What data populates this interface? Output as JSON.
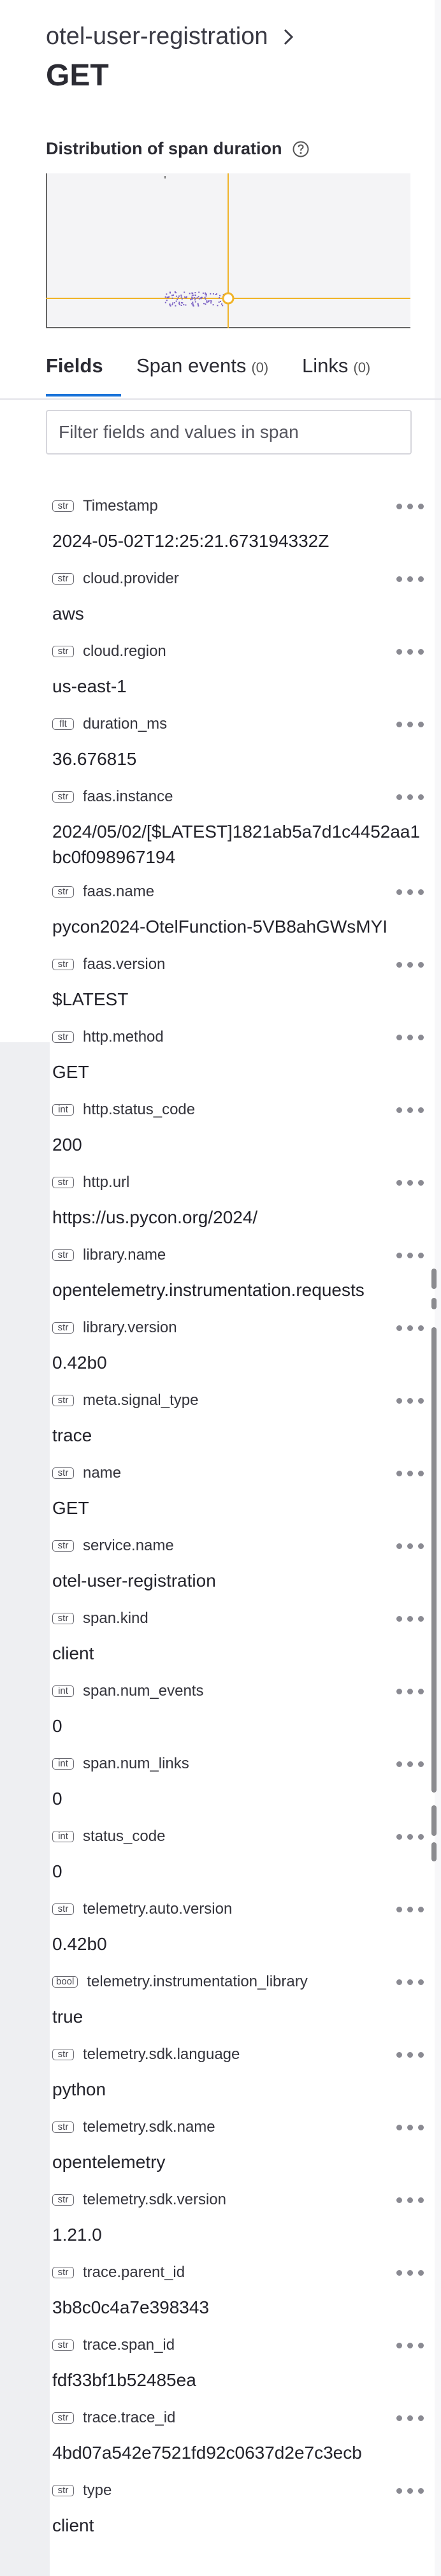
{
  "header": {
    "breadcrumb": "otel-user-registration",
    "title": "GET"
  },
  "distribution": {
    "title": "Distribution of span duration"
  },
  "colors": {
    "accent": "#1a73d9",
    "highlight_line": "#f0b429",
    "points": "#7b61c4"
  },
  "tabs": [
    {
      "label": "Fields",
      "count": ""
    },
    {
      "label": "Span events",
      "count": "(0)"
    },
    {
      "label": "Links",
      "count": "(0)"
    }
  ],
  "search": {
    "placeholder": "Filter fields and values in span",
    "value": ""
  },
  "fields": [
    {
      "type": "str",
      "name": "Timestamp",
      "value": "2024-05-02T12:25:21.673194332Z"
    },
    {
      "type": "str",
      "name": "cloud.provider",
      "value": "aws"
    },
    {
      "type": "str",
      "name": "cloud.region",
      "value": "us-east-1"
    },
    {
      "type": "flt",
      "name": "duration_ms",
      "value": "36.676815"
    },
    {
      "type": "str",
      "name": "faas.instance",
      "value": "2024/05/02/[$LATEST]1821ab5a7d1c4452aa1bc0f098967194"
    },
    {
      "type": "str",
      "name": "faas.name",
      "value": "pycon2024-OtelFunction-5VB8ahGWsMYI"
    },
    {
      "type": "str",
      "name": "faas.version",
      "value": "$LATEST"
    },
    {
      "type": "str",
      "name": "http.method",
      "value": "GET"
    },
    {
      "type": "int",
      "name": "http.status_code",
      "value": "200"
    },
    {
      "type": "str",
      "name": "http.url",
      "value": "https://us.pycon.org/2024/"
    },
    {
      "type": "str",
      "name": "library.name",
      "value": "opentelemetry.instrumentation.requests"
    },
    {
      "type": "str",
      "name": "library.version",
      "value": "0.42b0"
    },
    {
      "type": "str",
      "name": "meta.signal_type",
      "value": "trace"
    },
    {
      "type": "str",
      "name": "name",
      "value": "GET"
    },
    {
      "type": "str",
      "name": "service.name",
      "value": "otel-user-registration"
    },
    {
      "type": "str",
      "name": "span.kind",
      "value": "client"
    },
    {
      "type": "int",
      "name": "span.num_events",
      "value": "0"
    },
    {
      "type": "int",
      "name": "span.num_links",
      "value": "0"
    },
    {
      "type": "int",
      "name": "status_code",
      "value": "0"
    },
    {
      "type": "str",
      "name": "telemetry.auto.version",
      "value": "0.42b0"
    },
    {
      "type": "bool",
      "name": "telemetry.instrumentation_library",
      "value": "true"
    },
    {
      "type": "str",
      "name": "telemetry.sdk.language",
      "value": "python"
    },
    {
      "type": "str",
      "name": "telemetry.sdk.name",
      "value": "opentelemetry"
    },
    {
      "type": "str",
      "name": "telemetry.sdk.version",
      "value": "1.21.0"
    },
    {
      "type": "str",
      "name": "trace.parent_id",
      "value": "3b8c0c4a7e398343"
    },
    {
      "type": "str",
      "name": "trace.span_id",
      "value": "fdf33bf1b52485ea"
    },
    {
      "type": "str",
      "name": "trace.trace_id",
      "value": "4bd07a542e7521fd92c0637d2e7c3ecb"
    },
    {
      "type": "str",
      "name": "type",
      "value": "client"
    }
  ]
}
